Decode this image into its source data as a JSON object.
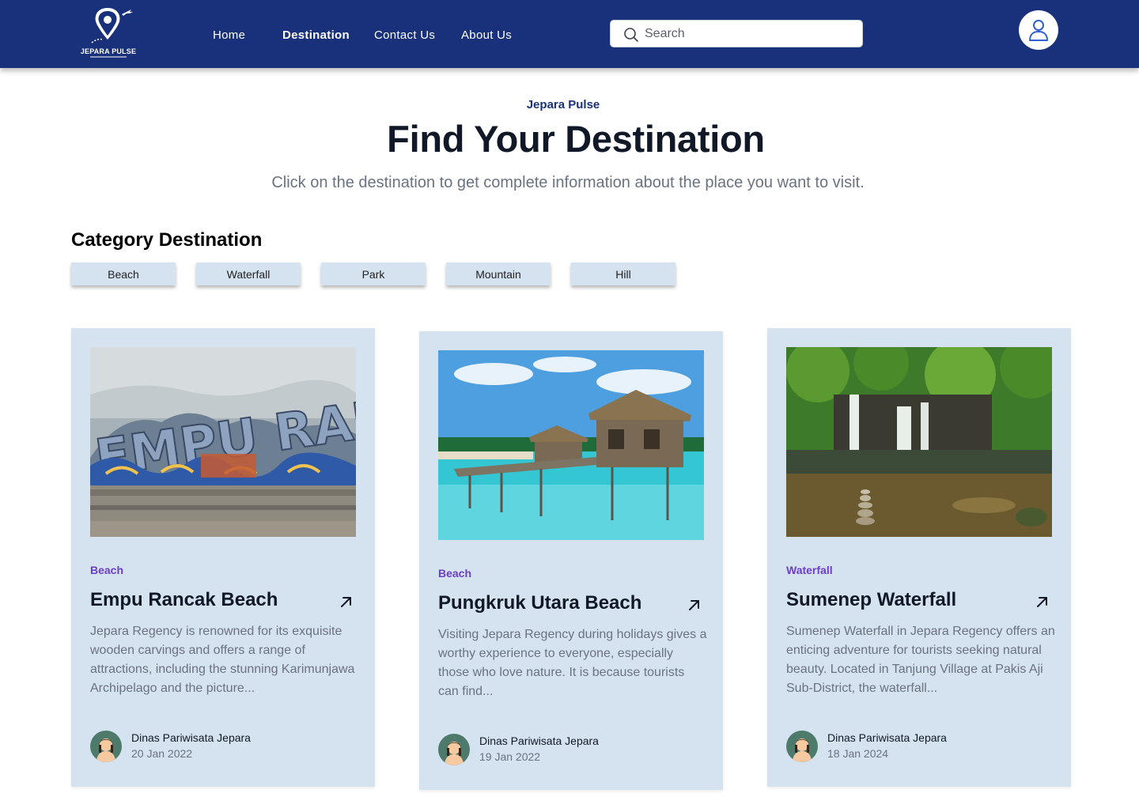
{
  "app": {
    "logo_text": "JEPARA PULSE"
  },
  "nav": {
    "items": [
      {
        "label": "Home"
      },
      {
        "label": "Destination"
      },
      {
        "label": "Contact Us"
      },
      {
        "label": "About Us"
      }
    ],
    "active": "Destination"
  },
  "search": {
    "placeholder": "Search",
    "icon": "search-icon"
  },
  "user": {
    "icon": "user-icon"
  },
  "hero": {
    "eyebrow": "Jepara Pulse",
    "title": "Find Your Destination",
    "subtitle": "Click on the destination to get complete information about the place you want to visit."
  },
  "categories": {
    "title": "Category Destination",
    "items": [
      {
        "label": "Beach"
      },
      {
        "label": "Waterfall"
      },
      {
        "label": "Park"
      },
      {
        "label": "Mountain"
      },
      {
        "label": "Hill"
      }
    ]
  },
  "cards": [
    {
      "category": "Beach",
      "title": "Empu Rancak Beach",
      "description": "Jepara Regency is renowned for its exquisite wooden carvings and offers a range of attractions, including the stunning Karimunjawa Archipelago and the picture...",
      "author": "Dinas Pariwisata Jepara",
      "date": "20 Jan 2022",
      "image": "beach-sign-photo"
    },
    {
      "category": "Beach",
      "title": "Pungkruk Utara Beach",
      "description": "Visiting Jepara Regency during holidays gives a worthy experience to everyone, especially those who love nature. It is because tourists can find...",
      "author": "Dinas Pariwisata Jepara",
      "date": "19 Jan 2022",
      "image": "water-bungalow-photo"
    },
    {
      "category": "Waterfall",
      "title": "Sumenep Waterfall",
      "description": "Sumenep Waterfall in Jepara Regency offers an enticing adventure for tourists seeking natural beauty. Located in Tanjung Village at Pakis Aji Sub-District, the waterfall...",
      "author": "Dinas Pariwisata Jepara",
      "date": "18 Jan 2024",
      "image": "waterfall-photo"
    }
  ],
  "colors": {
    "header": "#19317a",
    "card_bg": "#d5e2ef",
    "category_accent": "#6b3fc7"
  }
}
